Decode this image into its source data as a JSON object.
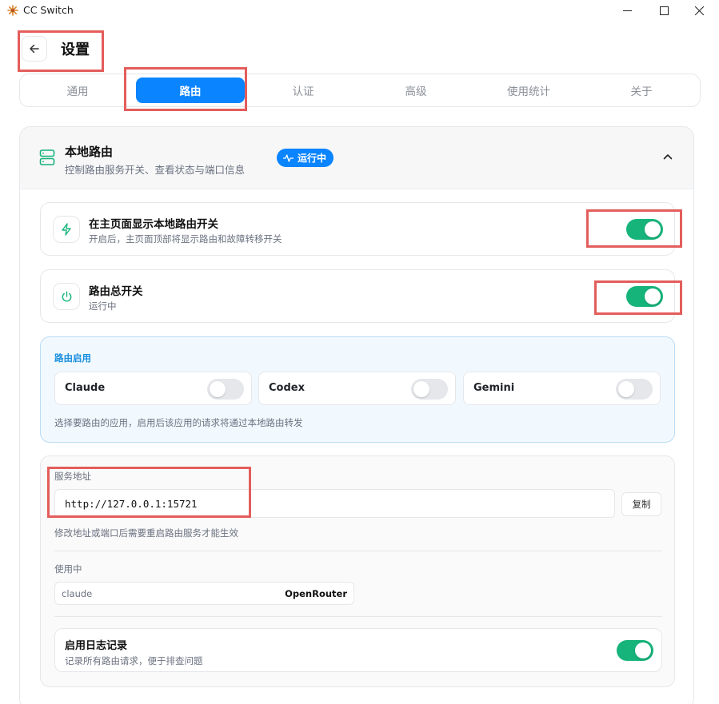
{
  "window": {
    "title": "CC Switch"
  },
  "header": {
    "title": "设置"
  },
  "tabs": [
    {
      "label": "通用",
      "active": false
    },
    {
      "label": "路由",
      "active": true
    },
    {
      "label": "认证",
      "active": false
    },
    {
      "label": "高级",
      "active": false
    },
    {
      "label": "使用统计",
      "active": false
    },
    {
      "label": "关于",
      "active": false
    }
  ],
  "section": {
    "title": "本地路由",
    "subtitle": "控制路由服务开关、查看状态与端口信息",
    "status": "运行中"
  },
  "show_switch_card": {
    "title": "在主页面显示本地路由开关",
    "subtitle": "开启后，主页面顶部将显示路由和故障转移开关",
    "enabled": true
  },
  "master_switch_card": {
    "title": "路由总开关",
    "subtitle": "运行中",
    "enabled": true
  },
  "route_apps": {
    "label": "路由启用",
    "apps": [
      {
        "name": "Claude",
        "enabled": false
      },
      {
        "name": "Codex",
        "enabled": false
      },
      {
        "name": "Gemini",
        "enabled": false
      }
    ],
    "hint": "选择要路由的应用，启用后该应用的请求将通过本地路由转发"
  },
  "service": {
    "address_label": "服务地址",
    "address_value": "http://127.0.0.1:15721",
    "copy_label": "复制",
    "hint": "修改地址或端口后需要重启路由服务才能生效",
    "in_use_label": "使用中",
    "in_use": {
      "app": "claude",
      "provider": "OpenRouter"
    }
  },
  "logging": {
    "title": "启用日志记录",
    "subtitle": "记录所有路由请求，便于排查问题",
    "enabled": true
  },
  "colors": {
    "accent": "#0a84ff",
    "toggle_on": "#16b47a",
    "highlight": "#e35d5b",
    "info_bg": "#f2f9fe"
  }
}
